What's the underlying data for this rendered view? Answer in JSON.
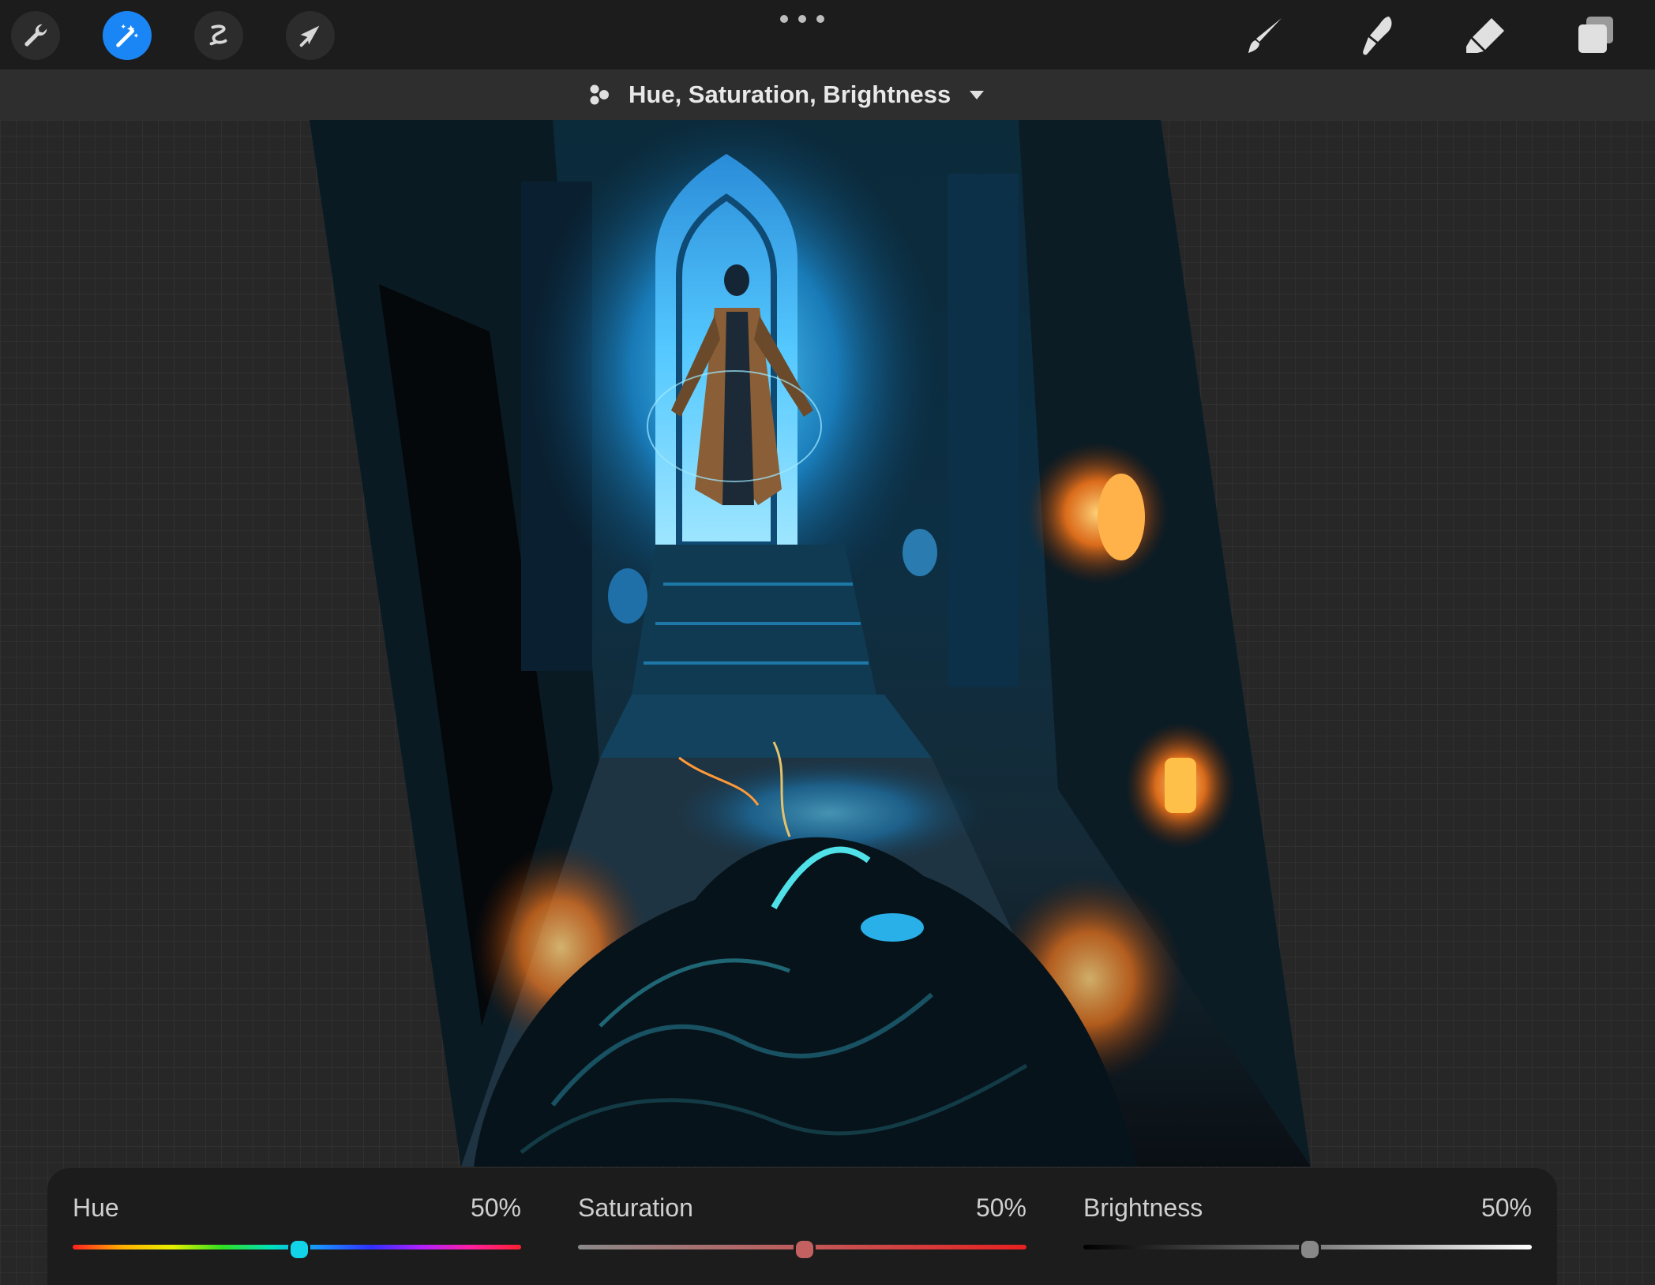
{
  "toolbar": {
    "left_tools": [
      {
        "icon": "wrench-icon",
        "name": "actions"
      },
      {
        "icon": "magic-wand-icon",
        "name": "adjustments",
        "active": true
      },
      {
        "icon": "selection-s-icon",
        "name": "selection"
      },
      {
        "icon": "arrow-cursor-icon",
        "name": "transform"
      }
    ],
    "more_icon": "ellipsis-icon",
    "right_tools": [
      {
        "icon": "brush-icon",
        "name": "paint"
      },
      {
        "icon": "smudge-icon",
        "name": "smudge"
      },
      {
        "icon": "eraser-icon",
        "name": "erase"
      },
      {
        "icon": "layers-icon",
        "name": "layers"
      }
    ],
    "accent_color": "#1a86f5"
  },
  "adjustment": {
    "title": "Hue, Saturation, Brightness",
    "mode_icon": "dots-cluster-icon",
    "dropdown_icon": "caret-down-icon"
  },
  "sliders": {
    "hue": {
      "label": "Hue",
      "value_text": "50%",
      "value": 0.5,
      "knob_color": "#12d4e8"
    },
    "saturation": {
      "label": "Saturation",
      "value_text": "50%",
      "value": 0.5,
      "knob_color": "#c36161"
    },
    "brightness": {
      "label": "Brightness",
      "value_text": "50%",
      "value": 0.5,
      "knob_color": "#888888"
    }
  }
}
